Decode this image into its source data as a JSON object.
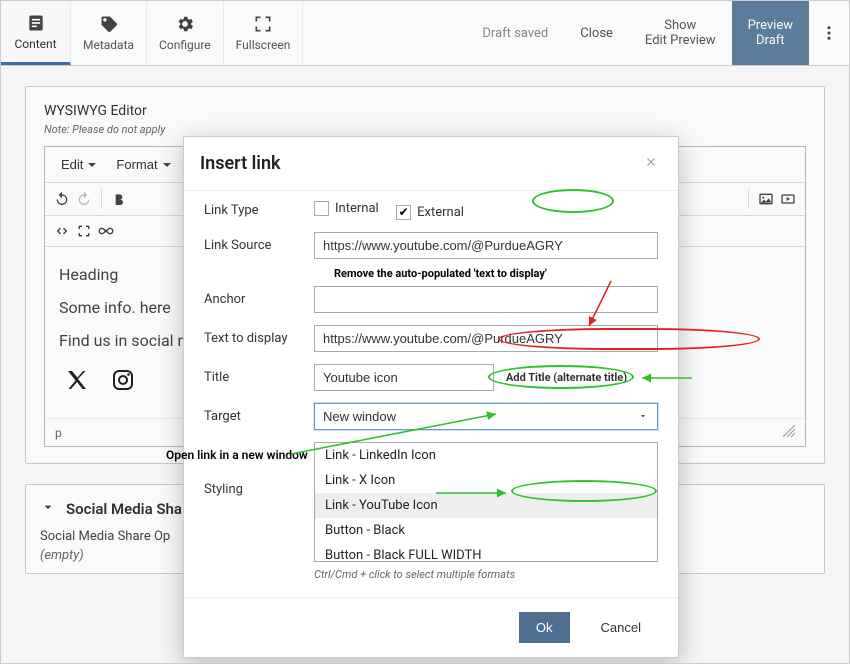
{
  "topbar": {
    "content": "Content",
    "metadata": "Metadata",
    "configure": "Configure",
    "fullscreen": "Fullscreen",
    "draft_saved": "Draft saved",
    "close": "Close",
    "show_line1": "Show",
    "show_line2": "Edit Preview",
    "preview_line1": "Preview",
    "preview_line2": "Draft"
  },
  "editor": {
    "title": "WYSIWYG Editor",
    "note": "Note: Please do not apply",
    "menu_edit": "Edit",
    "menu_format": "Format",
    "heading": "Heading",
    "some_info": "Some info. here",
    "find_us": "Find us in social m",
    "status_path": "p"
  },
  "accordion": {
    "title": "Social Media Sha",
    "row_label": "Social Media Share Op",
    "empty": "(empty)"
  },
  "modal": {
    "title": "Insert link",
    "label_link_type": "Link Type",
    "opt_internal": "Internal",
    "opt_external": "External",
    "label_link_source": "Link Source",
    "val_link_source": "https://www.youtube.com/@PurdueAGRY",
    "label_anchor": "Anchor",
    "val_anchor": "",
    "label_text_display": "Text to display",
    "val_text_display": "https://www.youtube.com/@PurdueAGRY",
    "label_title": "Title",
    "val_title": "Youtube icon",
    "label_target": "Target",
    "val_target": "New window",
    "label_styling": "Styling",
    "styling_options": [
      "Link - LinkedIn Icon",
      "Link - X Icon",
      "Link - YouTube Icon",
      "Button - Black",
      "Button - Black FULL WIDTH"
    ],
    "styling_selected_index": 2,
    "styling_helper": "Ctrl/Cmd + click to select multiple formats",
    "btn_ok": "Ok",
    "btn_cancel": "Cancel"
  },
  "annotations": {
    "remove_text": "Remove the auto-populated 'text to display'",
    "add_title": "Add Title (alternate title)",
    "open_new_window": "Open link in a new window"
  }
}
